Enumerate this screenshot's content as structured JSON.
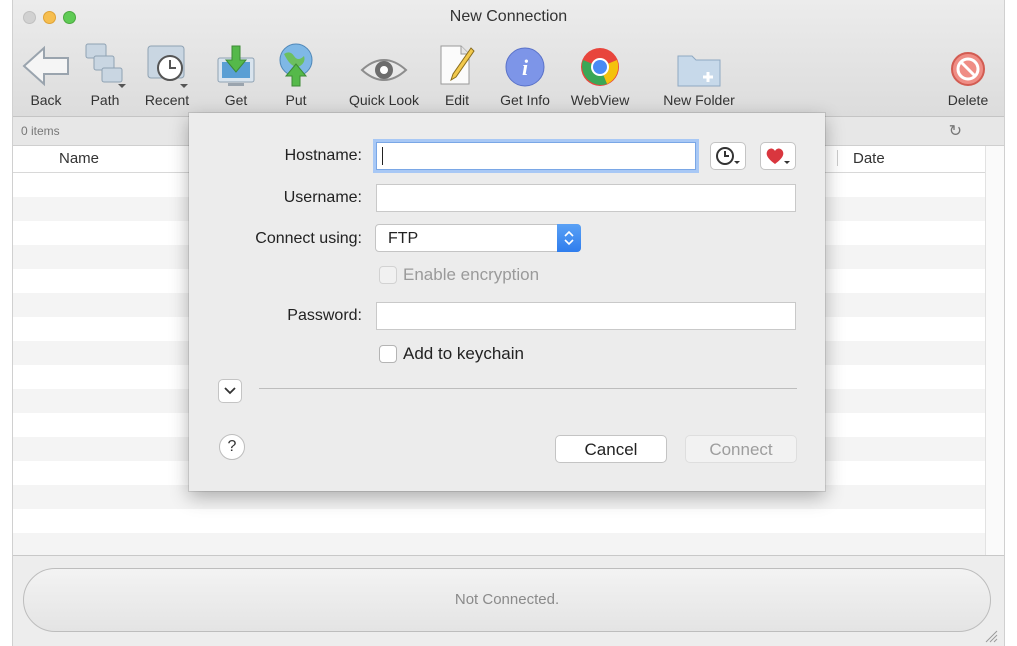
{
  "window": {
    "title": "New Connection"
  },
  "toolbar": {
    "items": [
      {
        "label": "Back",
        "icon": "back-arrow-icon"
      },
      {
        "label": "Path",
        "icon": "path-icon"
      },
      {
        "label": "Recent",
        "icon": "recent-icon"
      },
      {
        "label": "Get",
        "icon": "download-icon"
      },
      {
        "label": "Put",
        "icon": "upload-globe-icon"
      },
      {
        "label": "Quick Look",
        "icon": "eye-icon"
      },
      {
        "label": "Edit",
        "icon": "edit-pencil-icon"
      },
      {
        "label": "Get Info",
        "icon": "info-icon"
      },
      {
        "label": "WebView",
        "icon": "chrome-icon"
      },
      {
        "label": "New Folder",
        "icon": "new-folder-icon"
      },
      {
        "label": "Delete",
        "icon": "delete-icon"
      }
    ]
  },
  "status": {
    "items_count": "0 items"
  },
  "columns": {
    "name": "Name",
    "date": "Date"
  },
  "footer": {
    "status_text": "Not Connected."
  },
  "dialog": {
    "hostname_label": "Hostname:",
    "hostname_value": "",
    "username_label": "Username:",
    "username_value": "",
    "connect_label": "Connect using:",
    "connect_value": "FTP",
    "encryption_label": "Enable encryption",
    "password_label": "Password:",
    "password_value": "",
    "keychain_label": "Add to keychain",
    "help_label": "?",
    "cancel_label": "Cancel",
    "connect_button_label": "Connect"
  },
  "colors": {
    "accent_blue": "#2f7ded",
    "focus_ring": "#a8c8f5",
    "close": "#d1d1d1",
    "minimize": "#f6be4f",
    "maximize": "#5fcb55"
  }
}
